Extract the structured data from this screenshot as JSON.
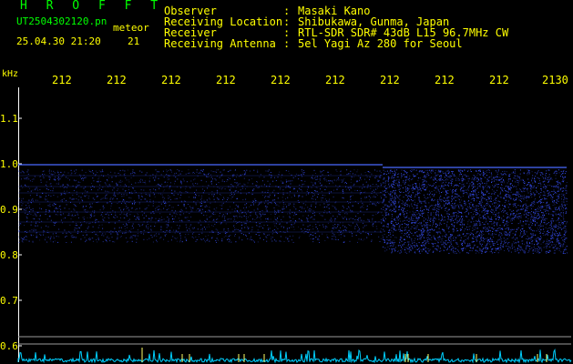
{
  "header": {
    "title": "H R O F F T",
    "filename": "UT2504302120.pn",
    "tag": "meteor",
    "datetime": "25.04.30 21:20",
    "count": "21",
    "rows": [
      {
        "label": "Observer",
        "value": "Masaki Kano"
      },
      {
        "label": "Receiving Location",
        "value": "Shibukawa, Gunma, Japan"
      },
      {
        "label": "Receiver",
        "value": "RTL-SDR SDR# 43dB L15 96.7MHz CW"
      },
      {
        "label": "Receiving Antenna",
        "value": "5el Yagi Az 280 for Seoul"
      }
    ],
    "colon": ":"
  },
  "axis": {
    "y_unit": "kHz",
    "x_ticks": [
      "212",
      "212",
      "212",
      "212",
      "212",
      "212",
      "212",
      "212",
      "212",
      "2130"
    ],
    "y_ticks": [
      "1.1",
      "1.0",
      "0.9",
      "0.8",
      "0.7",
      "0.6"
    ]
  },
  "colors": {
    "title": "#00ff00",
    "text": "#ffff00",
    "signal": "#3a52ff",
    "trace": "#00d0ff"
  }
}
